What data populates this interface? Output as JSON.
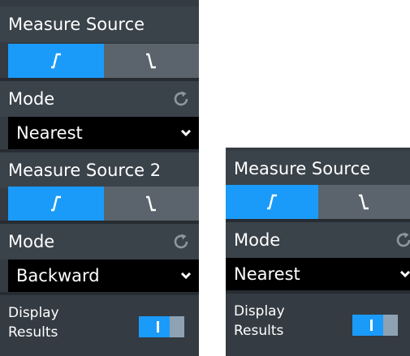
{
  "left_panel": {
    "section1": {
      "title": "Measure Source",
      "mode_label": "Mode",
      "mode_value": "Nearest"
    },
    "section2": {
      "title": "Measure Source 2",
      "mode_label": "Mode",
      "mode_value": "Backward"
    },
    "display_results": {
      "label_line1": "Display",
      "label_line2": "Results",
      "toggle_on": true
    }
  },
  "right_panel": {
    "title": "Measure Source",
    "mode_label": "Mode",
    "mode_value": "Nearest",
    "display_results": {
      "label_line1": "Display",
      "label_line2": "Results",
      "toggle_on": true
    }
  },
  "edge_selector": {
    "selected": "rising",
    "icons": [
      "rising-edge-icon",
      "falling-edge-icon"
    ]
  },
  "colors": {
    "panel": "#343b42",
    "active": "#1a9bfa",
    "inactive": "#5b646c",
    "dropdown": "#000000",
    "toggle_knob": "#8ea2b4"
  }
}
